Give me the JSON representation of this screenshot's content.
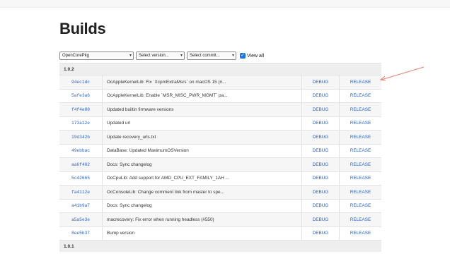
{
  "page": {
    "title": "Builds"
  },
  "filters": {
    "repo": "OpenCorePkg",
    "version": "Select version...",
    "commit": "Select commit...",
    "view_all_label": "View all",
    "view_all_checked": true
  },
  "versions": [
    {
      "label": "1.0.2",
      "commits": [
        {
          "hash": "94ec1dc",
          "message": "OcAppleKernelLib: Fix `XcpmExtraMsrs` on macOS 15 (#...",
          "debug": "DEBUG",
          "release": "RELEASE"
        },
        {
          "hash": "5afe3a6",
          "message": "OcAppleKernelLib: Enable `MSR_MISC_PWR_MGMT` pa...",
          "debug": "DEBUG",
          "release": "RELEASE"
        },
        {
          "hash": "f4f4e88",
          "message": "Updated builtin firmware versions",
          "debug": "DEBUG",
          "release": "RELEASE"
        },
        {
          "hash": "173a12e",
          "message": "Updated url",
          "debug": "DEBUG",
          "release": "RELEASE"
        },
        {
          "hash": "19d342b",
          "message": "Update recovery_urls.txt",
          "debug": "DEBUG",
          "release": "RELEASE"
        },
        {
          "hash": "49ebbac",
          "message": "DataBase: Updated MaximumOSVersion",
          "debug": "DEBUG",
          "release": "RELEASE"
        },
        {
          "hash": "aa6f402",
          "message": "Docs: Sync changelog",
          "debug": "DEBUG",
          "release": "RELEASE"
        },
        {
          "hash": "5c42665",
          "message": "OcCpuLib: Add support for AMD_CPU_EXT_FAMILY_1AH ...",
          "debug": "DEBUG",
          "release": "RELEASE"
        },
        {
          "hash": "fa4112e",
          "message": "OcConsoleLib: Change comment link from master to spe...",
          "debug": "DEBUG",
          "release": "RELEASE"
        },
        {
          "hash": "a41b9a7",
          "message": "Docs: Sync changelog",
          "debug": "DEBUG",
          "release": "RELEASE"
        },
        {
          "hash": "a5a5e3e",
          "message": "macrecovery: Fix error when running headless (#550)",
          "debug": "DEBUG",
          "release": "RELEASE"
        },
        {
          "hash": "8ee5b37",
          "message": "Bump version",
          "debug": "DEBUG",
          "release": "RELEASE"
        }
      ]
    },
    {
      "label": "1.0.1",
      "commits": []
    }
  ],
  "colors": {
    "link": "#2b63c8",
    "annotation_arrow": "#e8826f"
  }
}
